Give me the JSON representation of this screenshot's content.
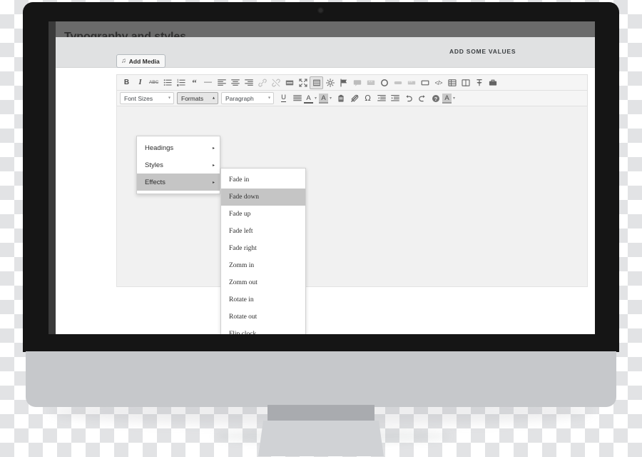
{
  "page": {
    "heading": "Typography and styles"
  },
  "panel": {
    "header_title": "ADD SOME VALUES"
  },
  "add_media": {
    "label": "Add Media",
    "icon": "media-icon"
  },
  "toolbar": {
    "row1": [
      {
        "name": "bold-button",
        "glyph": "B",
        "style": "bold-g",
        "pressed": false,
        "faded": false
      },
      {
        "name": "italic-button",
        "glyph": "I",
        "style": "ital-g",
        "pressed": false,
        "faded": false
      },
      {
        "name": "strikethrough-button",
        "glyph": "ABC",
        "style": "strike-g",
        "pressed": false,
        "faded": false
      },
      {
        "name": "bulleted-list-button",
        "icon": "bullet-list-icon",
        "pressed": false,
        "faded": false
      },
      {
        "name": "numbered-list-button",
        "icon": "numbered-list-icon",
        "pressed": false,
        "faded": false
      },
      {
        "name": "blockquote-button",
        "glyph": "“",
        "style": "quote-g",
        "pressed": false,
        "faded": false
      },
      {
        "name": "horizontal-rule-button",
        "glyph": "—",
        "style": "dash-g",
        "pressed": false,
        "faded": false
      },
      {
        "name": "align-left-button",
        "icon": "align-left-icon",
        "pressed": false,
        "faded": false
      },
      {
        "name": "align-center-button",
        "icon": "align-center-icon",
        "pressed": false,
        "faded": false
      },
      {
        "name": "align-right-button",
        "icon": "align-right-icon",
        "pressed": false,
        "faded": false
      },
      {
        "name": "insert-link-button",
        "icon": "link-icon",
        "pressed": false,
        "faded": true
      },
      {
        "name": "unlink-button",
        "icon": "unlink-icon",
        "pressed": false,
        "faded": true
      },
      {
        "name": "insert-more-tag-button",
        "icon": "more-tag-icon",
        "pressed": false,
        "faded": false
      },
      {
        "name": "fullscreen-button",
        "icon": "fullscreen-icon",
        "pressed": false,
        "faded": false
      },
      {
        "name": "toggle-toolbar-button",
        "icon": "kitchen-sink-icon",
        "pressed": true,
        "faded": false
      },
      {
        "name": "settings-button",
        "icon": "gear-icon",
        "pressed": false,
        "faded": false
      },
      {
        "name": "flag-button",
        "icon": "flag-icon",
        "pressed": false,
        "faded": false
      },
      {
        "name": "comment-button",
        "icon": "comment-icon",
        "pressed": false,
        "faded": true
      },
      {
        "name": "quote-block-button",
        "icon": "quote-block-icon",
        "pressed": false,
        "faded": true
      },
      {
        "name": "circle-button",
        "icon": "circle-icon",
        "pressed": false,
        "faded": false
      },
      {
        "name": "button-shortcode-button",
        "icon": "button-icon",
        "pressed": false,
        "faded": true
      },
      {
        "name": "pullquote-button",
        "icon": "pullquote-icon",
        "pressed": false,
        "faded": true
      },
      {
        "name": "box-button",
        "icon": "box-icon",
        "pressed": false,
        "faded": false
      },
      {
        "name": "source-code-button",
        "glyph": "</>",
        "style": "code-g",
        "pressed": false,
        "faded": false
      },
      {
        "name": "insert-table-button",
        "icon": "table-icon",
        "pressed": false,
        "faded": false
      },
      {
        "name": "columns-button",
        "icon": "columns-icon",
        "pressed": false,
        "faded": false
      },
      {
        "name": "pin-button",
        "icon": "pin-icon",
        "pressed": false,
        "faded": false
      },
      {
        "name": "briefcase-button",
        "icon": "briefcase-icon",
        "pressed": false,
        "faded": false
      }
    ],
    "selects": [
      {
        "name": "font-sizes-select",
        "id": "sel-fontsizes",
        "label": "Font Sizes",
        "caret": "▾",
        "expanded": false
      },
      {
        "name": "formats-select",
        "id": "sel-formats",
        "label": "Formats",
        "caret": "▴",
        "expanded": true
      },
      {
        "name": "paragraph-select",
        "id": "sel-paragraph",
        "label": "Paragraph",
        "caret": "▾",
        "expanded": false
      }
    ],
    "row2": [
      {
        "name": "underline-button",
        "glyph": "U",
        "style": "uline-g",
        "faded": false
      },
      {
        "name": "justify-button",
        "icon": "align-justify-icon",
        "faded": false
      },
      {
        "name": "text-color-button",
        "icon": "text-color-a-icon",
        "kind": "acolor",
        "hl": false
      },
      {
        "name": "highlight-color-button",
        "icon": "highlight-color-a-icon",
        "kind": "acolor",
        "hl": true
      },
      {
        "name": "paste-as-text-button",
        "icon": "clipboard-icon",
        "faded": false
      },
      {
        "name": "clear-formatting-button",
        "icon": "eraser-icon",
        "faded": false
      },
      {
        "name": "special-character-button",
        "glyph": "Ω",
        "style": "omega-g",
        "faded": false
      },
      {
        "name": "decrease-indent-button",
        "icon": "outdent-icon",
        "faded": false
      },
      {
        "name": "increase-indent-button",
        "icon": "indent-icon",
        "faded": false
      },
      {
        "name": "undo-button",
        "icon": "undo-icon",
        "faded": false
      },
      {
        "name": "redo-button",
        "icon": "redo-icon",
        "faded": false
      },
      {
        "name": "keyboard-shortcuts-button",
        "icon": "help-icon",
        "faded": false
      },
      {
        "name": "shortcode-color-button",
        "icon": "highlight-color-a-icon",
        "kind": "acolor",
        "hl": true
      }
    ]
  },
  "formats_menu": {
    "items": [
      {
        "label": "Headings",
        "has_submenu": true,
        "active": false,
        "arrow": "▸"
      },
      {
        "label": "Styles",
        "has_submenu": true,
        "active": false,
        "arrow": "▸"
      },
      {
        "label": "Effects",
        "has_submenu": true,
        "active": true,
        "arrow": "▸"
      }
    ]
  },
  "effects_submenu": {
    "items": [
      {
        "label": "Fade in",
        "active": false
      },
      {
        "label": "Fade down",
        "active": true
      },
      {
        "label": "Fade up",
        "active": false
      },
      {
        "label": "Fade left",
        "active": false
      },
      {
        "label": "Fade right",
        "active": false
      },
      {
        "label": "Zomm in",
        "active": false
      },
      {
        "label": "Zomm out",
        "active": false
      },
      {
        "label": "Rotate in",
        "active": false
      },
      {
        "label": "Rotate out",
        "active": false
      },
      {
        "label": "Flip clock",
        "active": false
      }
    ]
  },
  "colors": {
    "bezel": "#151515",
    "chin": "#c6c8cb",
    "page_bg": "#6b6b6b",
    "panel_header": "#e0e1e2",
    "toolbar": "#f5f5f5",
    "editor_area": "#f1f1f1",
    "menu_active": "#c5c5c5"
  }
}
